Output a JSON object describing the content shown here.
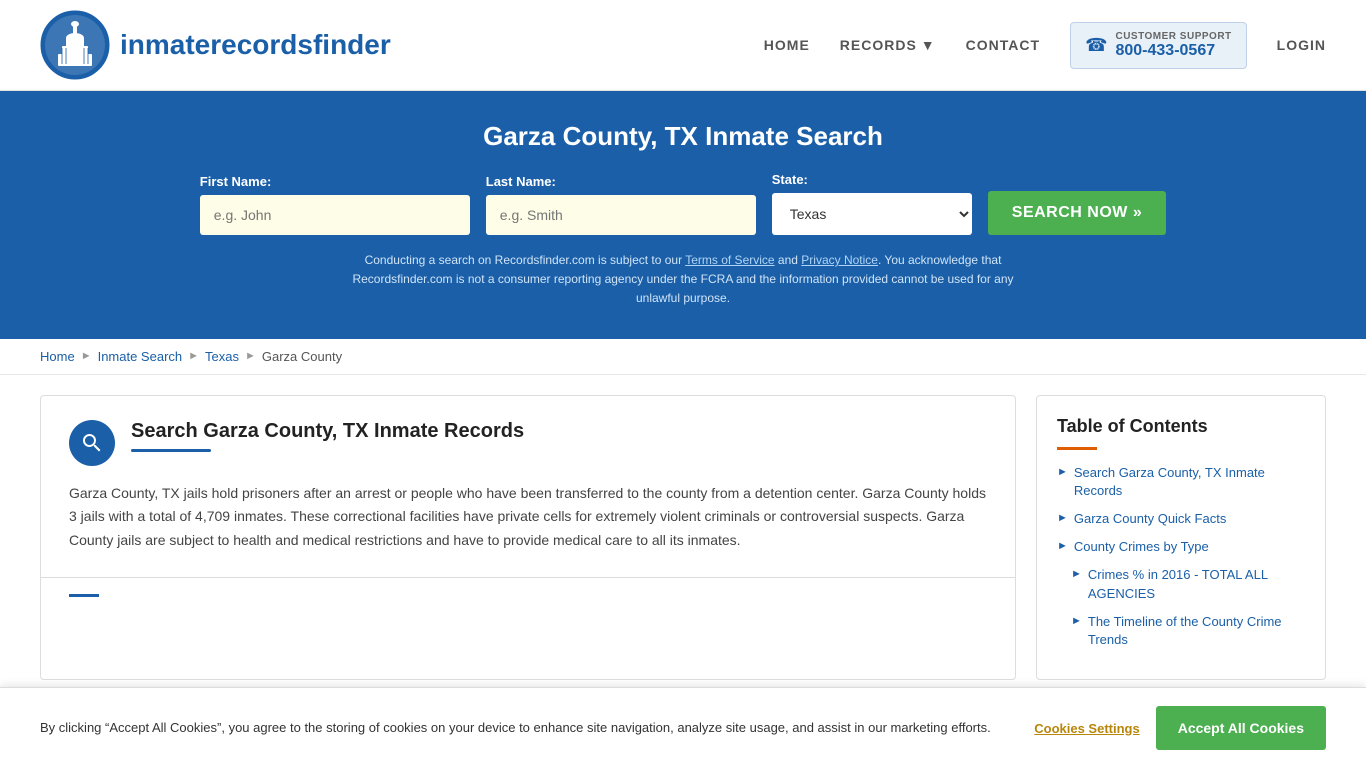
{
  "header": {
    "logo_text_light": "inmaterecords",
    "logo_text_bold": "finder",
    "nav": {
      "home": "HOME",
      "records": "RECORDS",
      "contact": "CONTACT",
      "login": "LOGIN"
    },
    "support": {
      "label": "CUSTOMER SUPPORT",
      "phone": "800-433-0567"
    }
  },
  "hero": {
    "title": "Garza County, TX Inmate Search",
    "form": {
      "first_name_label": "First Name:",
      "first_name_placeholder": "e.g. John",
      "last_name_label": "Last Name:",
      "last_name_placeholder": "e.g. Smith",
      "state_label": "State:",
      "state_value": "Texas",
      "search_button": "SEARCH NOW »"
    },
    "disclaimer": "Conducting a search on Recordsfinder.com is subject to our Terms of Service and Privacy Notice. You acknowledge that Recordsfinder.com is not a consumer reporting agency under the FCRA and the information provided cannot be used for any unlawful purpose."
  },
  "breadcrumb": {
    "home": "Home",
    "inmate_search": "Inmate Search",
    "texas": "Texas",
    "county": "Garza County"
  },
  "main": {
    "section1": {
      "title": "Search Garza County, TX Inmate Records",
      "body": "Garza County, TX jails hold prisoners after an arrest or people who have been transferred to the county from a detention center. Garza County holds 3 jails with a total of 4,709 inmates. These correctional facilities have private cells for extremely violent criminals or controversial suspects. Garza County jails are subject to health and medical restrictions and have to provide medical care to all its inmates."
    }
  },
  "toc": {
    "title": "Table of Contents",
    "items": [
      {
        "label": "Search Garza County, TX Inmate Records",
        "sub": false
      },
      {
        "label": "Garza County Quick Facts",
        "sub": false
      },
      {
        "label": "County Crimes by Type",
        "sub": false
      },
      {
        "label": "Crimes % in 2016 - TOTAL ALL AGENCIES",
        "sub": true
      },
      {
        "label": "The Timeline of the County Crime Trends",
        "sub": true
      }
    ]
  },
  "cookie": {
    "text": "By clicking “Accept All Cookies”, you agree to the storing of cookies on your device to enhance site navigation, analyze site usage, and assist in our marketing efforts.",
    "settings_btn": "Cookies Settings",
    "accept_btn": "Accept All Cookies"
  }
}
